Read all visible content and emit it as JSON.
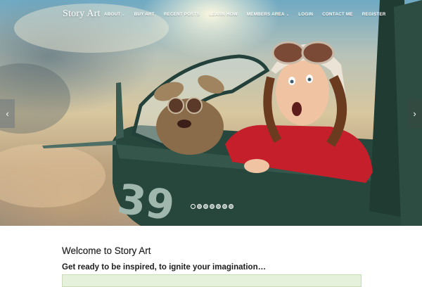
{
  "site": {
    "title": "Story Art"
  },
  "nav": {
    "items": [
      {
        "label": "ABOUT",
        "has_dropdown": true
      },
      {
        "label": "BUY ART",
        "has_dropdown": false
      },
      {
        "label": "RECENT POSTS",
        "has_dropdown": false
      },
      {
        "label": "LEARN HOW",
        "has_dropdown": false
      },
      {
        "label": "MEMBERS AREA",
        "has_dropdown": true
      },
      {
        "label": "LOGIN",
        "has_dropdown": false
      },
      {
        "label": "CONTACT ME",
        "has_dropdown": false
      },
      {
        "label": "REGISTER",
        "has_dropdown": false
      }
    ]
  },
  "slider": {
    "prev_icon": "chevron-left-icon",
    "next_icon": "chevron-right-icon",
    "slide_count": 7,
    "active_index": 0
  },
  "main": {
    "heading": "Welcome to Story Art",
    "subheading": "Get ready to be inspired, to ignite your imagination…"
  },
  "notice": {
    "text": ""
  },
  "colors": {
    "notice_bg": "#e6f1dc",
    "heading": "#1e1e1e",
    "plane": "#24463c"
  }
}
